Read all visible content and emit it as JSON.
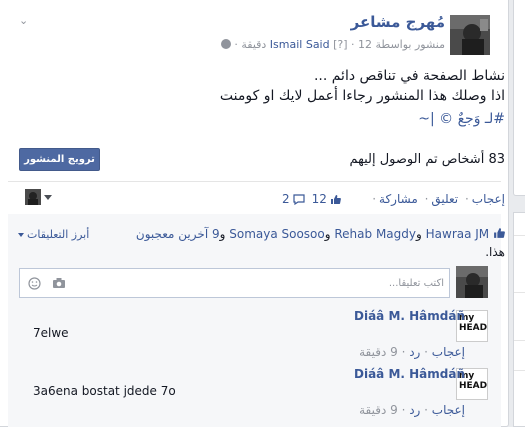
{
  "post": {
    "page_name": "مُهرج مشاعر",
    "meta_published": "منشور بواسطة",
    "meta_author": "Ismail Said",
    "meta_badge": "[?]",
    "meta_time": "12 دقيقة",
    "text_line1": "نشاط الصفحة في تناقص دائم ...",
    "text_line2": "اذا وصلك هذا المنشور رجاءا أعمل لايك او كومنت",
    "hashtag": "#لـ وَجعٌ © |~"
  },
  "boost": {
    "button_label": "ترويج المنشور"
  },
  "reach": {
    "text": "83 أشخاص تم الوصول إليهم"
  },
  "actions": {
    "like": "إعجاب",
    "comment": "تعليق",
    "share": "مشاركة",
    "likes_count": "12",
    "comments_count": "2"
  },
  "likers": {
    "name1": "Hawraa JM",
    "name2": "Rehab Magdy",
    "name3": "Somaya Soosoo",
    "and1": "و",
    "and2": "و",
    "others": "9 آخرين معجبون",
    "suffix": "هذا.",
    "top_comments": "أبرز التعليقات"
  },
  "comment_input": {
    "placeholder": "اكتب تعليقاً..."
  },
  "comments": [
    {
      "author": "Diáâ M. Hâmdáñ",
      "text": "7elwe",
      "like": "إعجاب",
      "reply": "رد",
      "time": "9 دقيقة",
      "avatar_label": "my HEAD"
    },
    {
      "author": "Diáâ M. Hâmdáñ",
      "text": "3a6ena bostat jdede 7o",
      "like": "إعجاب",
      "reply": "رد",
      "time": "9 دقيقة",
      "avatar_label": "my HEAD"
    }
  ],
  "colors": {
    "link": "#3b5998",
    "button": "#4e69a2",
    "muted": "#90949c"
  }
}
